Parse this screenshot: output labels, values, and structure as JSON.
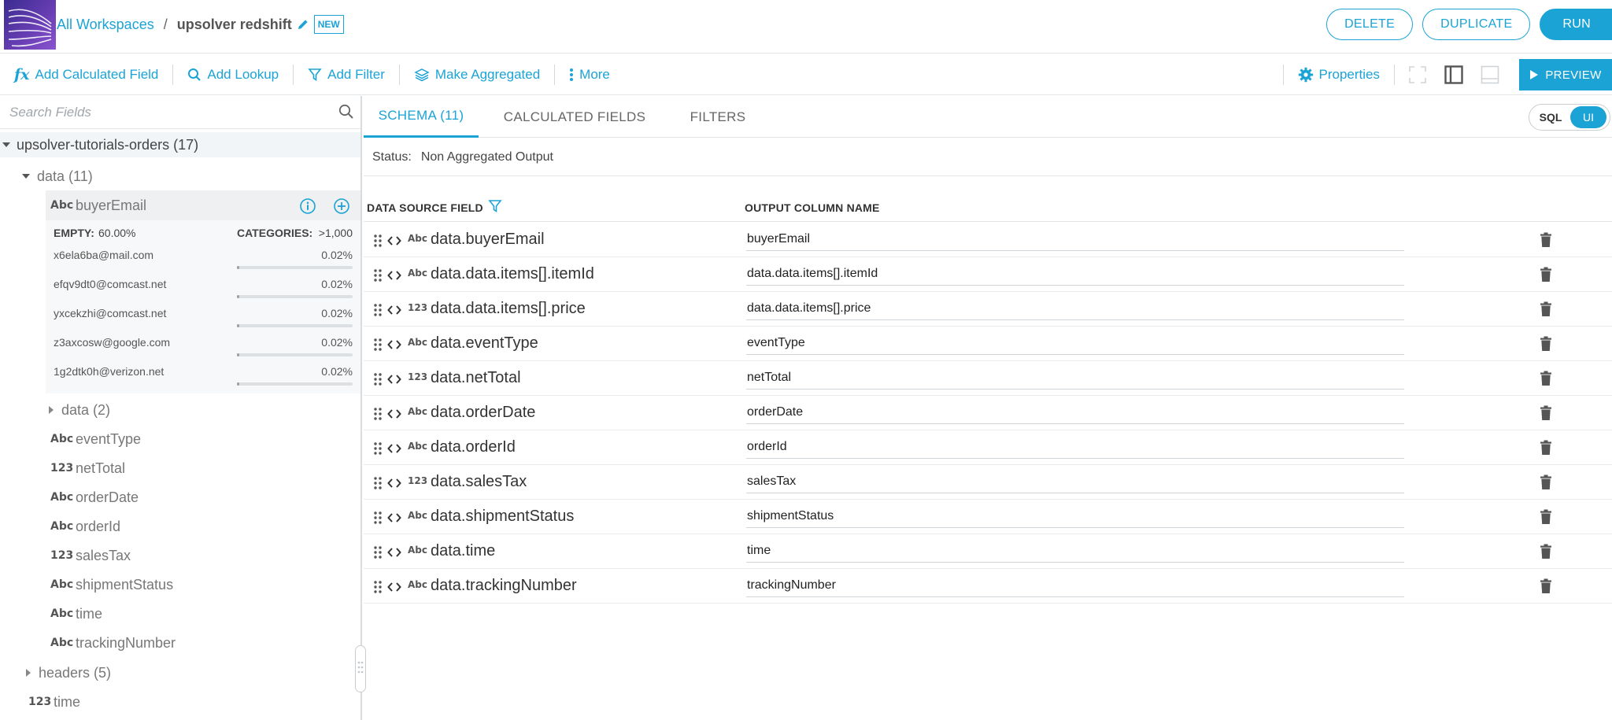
{
  "breadcrumb": {
    "workspaces": "All Workspaces",
    "separator": "/",
    "current": "upsolver redshift",
    "badge": "NEW"
  },
  "actions": {
    "delete": "DELETE",
    "duplicate": "DUPLICATE",
    "run": "RUN"
  },
  "toolbar": {
    "add_calculated": "Add Calculated Field",
    "add_lookup": "Add Lookup",
    "add_filter": "Add Filter",
    "make_aggregated": "Make Aggregated",
    "more": "More",
    "properties": "Properties",
    "preview": "PREVIEW"
  },
  "sidebar": {
    "search_placeholder": "Search Fields",
    "root": "upsolver-tutorials-orders (17)",
    "data_group": "data (11)",
    "selected_field": {
      "type": "Abc",
      "name": "buyerEmail"
    },
    "stats": {
      "empty_label": "EMPTY:",
      "empty_value": "60.00%",
      "categories_label": "CATEGORIES:",
      "categories_value": ">1,000",
      "rows": [
        {
          "value": "x6ela6ba@mail.com",
          "pct": "0.02%",
          "share": 0.02
        },
        {
          "value": "efqv9dt0@comcast.net",
          "pct": "0.02%",
          "share": 0.02
        },
        {
          "value": "yxcekzhi@comcast.net",
          "pct": "0.02%",
          "share": 0.02
        },
        {
          "value": "z3axcosw@google.com",
          "pct": "0.02%",
          "share": 0.02
        },
        {
          "value": "1g2dtk0h@verizon.net",
          "pct": "0.02%",
          "share": 0.02
        }
      ]
    },
    "subgroup": "data (2)",
    "fields": [
      {
        "type": "Abc",
        "name": "eventType"
      },
      {
        "type": "123",
        "name": "netTotal"
      },
      {
        "type": "Abc",
        "name": "orderDate"
      },
      {
        "type": "Abc",
        "name": "orderId"
      },
      {
        "type": "123",
        "name": "salesTax"
      },
      {
        "type": "Abc",
        "name": "shipmentStatus"
      },
      {
        "type": "Abc",
        "name": "time"
      },
      {
        "type": "Abc",
        "name": "trackingNumber"
      }
    ],
    "headers_group": "headers (5)",
    "time_field": {
      "type": "123",
      "name": "time"
    }
  },
  "tabs": {
    "schema": "SCHEMA (11)",
    "calculated": "CALCULATED FIELDS",
    "filters": "FILTERS"
  },
  "toggle": {
    "sql": "SQL",
    "ui": "UI"
  },
  "status": {
    "label": "Status:",
    "value": "Non Aggregated Output"
  },
  "grid": {
    "col_source": "DATA SOURCE FIELD",
    "col_output": "OUTPUT COLUMN NAME",
    "rows": [
      {
        "type": "Abc",
        "source": "data.buyerEmail",
        "output": "buyerEmail"
      },
      {
        "type": "Abc",
        "source": "data.data.items[].itemId",
        "output": "data.data.items[].itemId"
      },
      {
        "type": "123",
        "source": "data.data.items[].price",
        "output": "data.data.items[].price"
      },
      {
        "type": "Abc",
        "source": "data.eventType",
        "output": "eventType"
      },
      {
        "type": "123",
        "source": "data.netTotal",
        "output": "netTotal"
      },
      {
        "type": "Abc",
        "source": "data.orderDate",
        "output": "orderDate"
      },
      {
        "type": "Abc",
        "source": "data.orderId",
        "output": "orderId"
      },
      {
        "type": "123",
        "source": "data.salesTax",
        "output": "salesTax"
      },
      {
        "type": "Abc",
        "source": "data.shipmentStatus",
        "output": "shipmentStatus"
      },
      {
        "type": "Abc",
        "source": "data.time",
        "output": "time"
      },
      {
        "type": "Abc",
        "source": "data.trackingNumber",
        "output": "trackingNumber"
      }
    ]
  },
  "colors": {
    "accent": "#1ba3d6",
    "logo": "#6a3fb5"
  }
}
